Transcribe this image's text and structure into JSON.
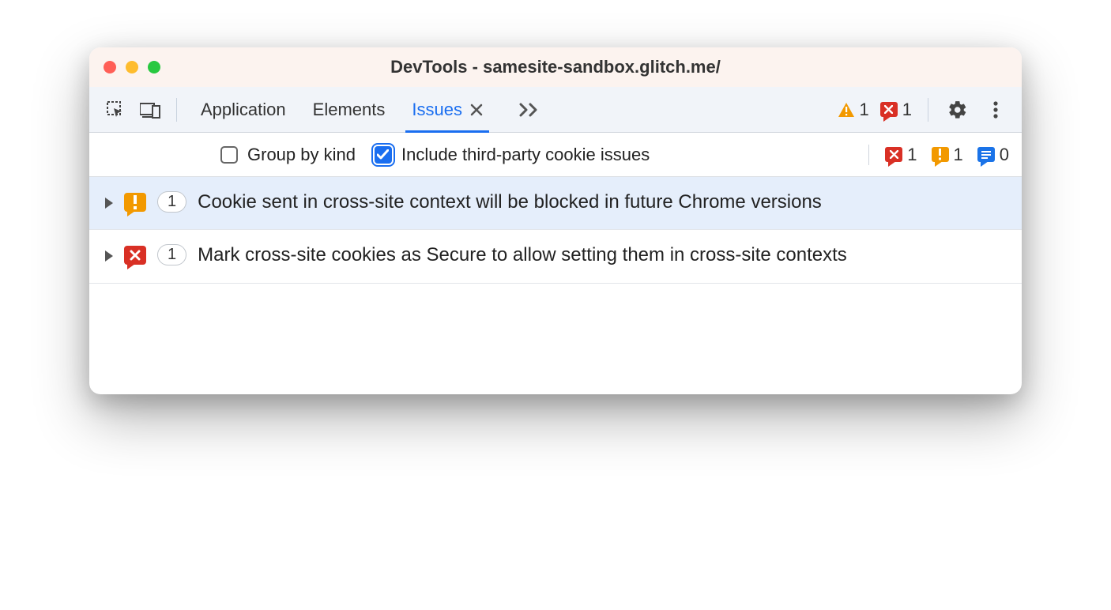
{
  "window": {
    "title": "DevTools - samesite-sandbox.glitch.me/"
  },
  "tabs": {
    "items": [
      {
        "label": "Application",
        "active": false
      },
      {
        "label": "Elements",
        "active": false
      },
      {
        "label": "Issues",
        "active": true
      }
    ]
  },
  "toolbar_counts": {
    "warning": "1",
    "error": "1"
  },
  "filterbar": {
    "group_by_kind": {
      "label": "Group by kind",
      "checked": false
    },
    "include_third_party": {
      "label": "Include third-party cookie issues",
      "checked": true
    },
    "counts": {
      "error": "1",
      "warning": "1",
      "info": "0"
    }
  },
  "issues": [
    {
      "severity": "warning",
      "count": "1",
      "title": "Cookie sent in cross-site context will be blocked in future Chrome versions",
      "selected": true
    },
    {
      "severity": "error",
      "count": "1",
      "title": "Mark cross-site cookies as Secure to allow setting them in cross-site contexts",
      "selected": false
    }
  ]
}
